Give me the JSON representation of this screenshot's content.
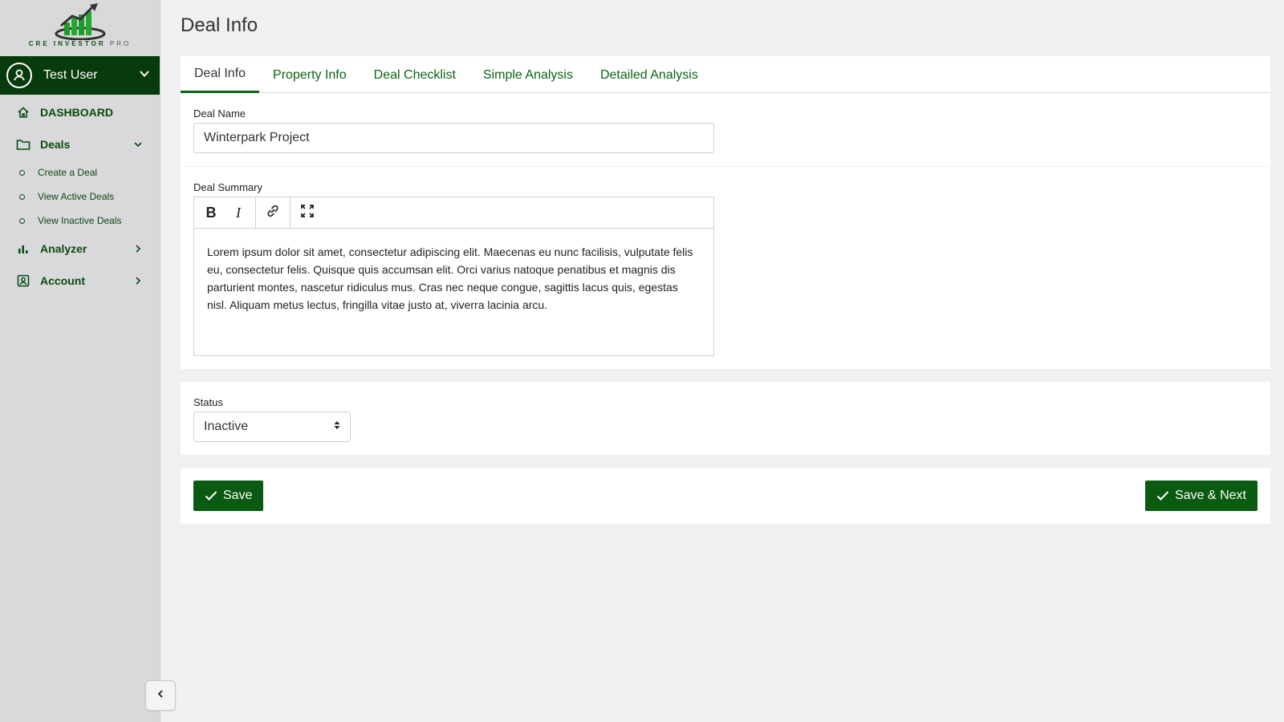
{
  "brand": {
    "name": "CRE INVESTOR",
    "suffix": "PRO"
  },
  "user": {
    "name": "Test User"
  },
  "nav": {
    "dashboard": "DASHBOARD",
    "deals": "Deals",
    "deals_sub": [
      "Create a Deal",
      "View Active Deals",
      "View Inactive Deals"
    ],
    "analyzer": "Analyzer",
    "account": "Account"
  },
  "page": {
    "title": "Deal Info"
  },
  "tabs": [
    "Deal Info",
    "Property Info",
    "Deal Checklist",
    "Simple Analysis",
    "Detailed Analysis"
  ],
  "form": {
    "deal_name_label": "Deal Name",
    "deal_name_value": "Winterpark Project",
    "deal_summary_label": "Deal Summary",
    "deal_summary_text": "Lorem ipsum dolor sit amet, consectetur adipiscing elit. Maecenas eu nunc facilisis, vulputate felis eu, consectetur felis. Quisque quis accumsan elit. Orci varius natoque penatibus et magnis dis parturient montes, nascetur ridiculus mus. Cras nec neque congue, sagittis lacus quis, egestas nisl. Aliquam metus lectus, fringilla vitae justo at, viverra lacinia arcu.",
    "status_label": "Status",
    "status_value": "Inactive"
  },
  "toolbar": {
    "bold": "B",
    "italic": "I"
  },
  "buttons": {
    "save": "Save",
    "save_next": "Save & Next"
  },
  "colors": {
    "accent": "#0b5a12",
    "user_bar": "#083b0c",
    "sidebar_bg": "#d9d9dc",
    "page_bg": "#f0f0f3"
  }
}
